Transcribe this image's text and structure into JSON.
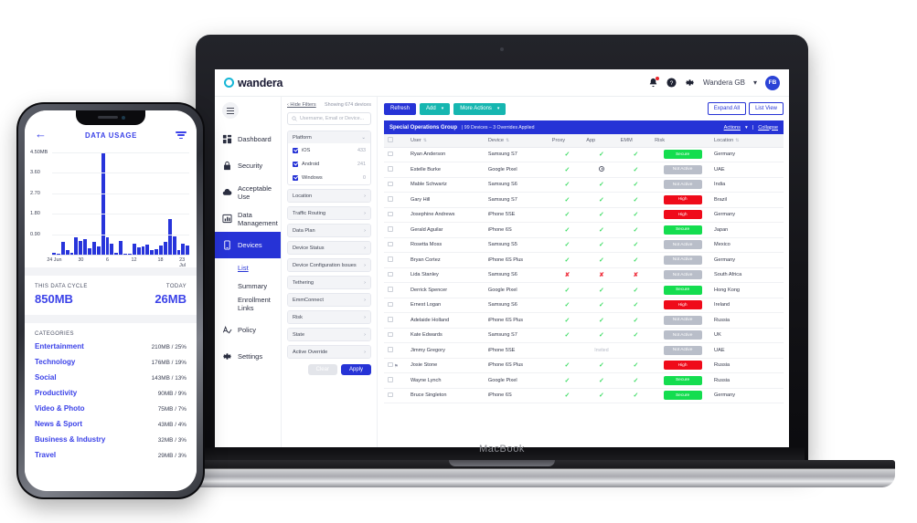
{
  "laptop": {
    "brand_label": "MacBook",
    "header": {
      "logo_text": "wandera",
      "logo_icon": "circle-o-icon",
      "bell_icon": "bell-icon",
      "help_icon": "help-circle-icon",
      "gear_icon": "gear-icon",
      "tenant": "Wandera GB",
      "tenant_caret": "▾",
      "avatar_initials": "FB"
    },
    "sidebar": {
      "menu_icon": "hamburger-icon",
      "items": [
        {
          "label": "Dashboard",
          "icon": "dashboard-icon",
          "active": false
        },
        {
          "label": "Security",
          "icon": "lock-icon",
          "active": false
        },
        {
          "label": "Acceptable Use",
          "icon": "cloud-icon",
          "active": false
        },
        {
          "label": "Data Management",
          "icon": "chart-bar-icon",
          "active": false
        },
        {
          "label": "Devices",
          "icon": "mobile-icon",
          "active": true
        }
      ],
      "sub_items": [
        {
          "label": "List",
          "selected": true
        },
        {
          "label": "Summary",
          "selected": false
        },
        {
          "label": "Enrollment Links",
          "selected": false
        }
      ],
      "footer_items": [
        {
          "label": "Policy",
          "icon": "policy-icon"
        },
        {
          "label": "Settings",
          "icon": "gear-icon"
        }
      ]
    },
    "filters": {
      "hide_link": "‹ Hide Filters",
      "showing": "Showing 674 devices",
      "search_placeholder": "Username, Email or Device...",
      "search_icon": "search-icon",
      "platform": {
        "label": "Platform",
        "caret": "⌄",
        "options": [
          {
            "label": "iOS",
            "count": "433",
            "checked": true
          },
          {
            "label": "Android",
            "count": "241",
            "checked": true
          },
          {
            "label": "Windows",
            "count": "0",
            "checked": true
          }
        ]
      },
      "groups": [
        "Location",
        "Traffic Routing",
        "Data Plan",
        "Device Status",
        "Device Configuration Issues",
        "Tethering",
        "EmmConnect",
        "Risk",
        "State",
        "Active Override"
      ],
      "chevron": "›",
      "clear_label": "Clear",
      "apply_label": "Apply"
    },
    "toolbar": {
      "refresh_label": "Refresh",
      "add_label": "Add",
      "more_actions_label": "More Actions",
      "caret": "▾",
      "expand_all_label": "Expand All",
      "list_view_label": "List View"
    },
    "group_bar": {
      "name": "Special Operations Group",
      "meta": "| 99 Devices – 3 Overrides Applied",
      "actions_label": "Actions",
      "actions_caret": "▾",
      "divider": "|",
      "collapse_label": "Collapse"
    },
    "table": {
      "columns": [
        "",
        "User",
        "Device",
        "Proxy",
        "App",
        "EMM",
        "Risk",
        "Location"
      ],
      "sort_icon": "sort-icon",
      "rows": [
        {
          "user": "Ryan Anderson",
          "device": "Samsung S7",
          "proxy": "tick",
          "app": "tick",
          "emm": "tick",
          "risk": "Secure",
          "risk_state": "secure",
          "location": "Germany"
        },
        {
          "user": "Estelle Burke",
          "device": "Google Pixel",
          "proxy": "tick",
          "app": "clock",
          "emm": "tick",
          "risk": "Not Active",
          "risk_state": "na",
          "location": "UAE"
        },
        {
          "user": "Mable Schwartz",
          "device": "Samsung S6",
          "proxy": "tick",
          "app": "tick",
          "emm": "tick",
          "risk": "Not Active",
          "risk_state": "na",
          "location": "India"
        },
        {
          "user": "Gary Hill",
          "device": "Samsung S7",
          "proxy": "tick",
          "app": "tick",
          "emm": "tick",
          "risk": "High",
          "risk_state": "high",
          "location": "Brazil"
        },
        {
          "user": "Josephine Andrews",
          "device": "iPhone 5SE",
          "proxy": "tick",
          "app": "tick",
          "emm": "tick",
          "risk": "High",
          "risk_state": "high",
          "location": "Germany"
        },
        {
          "user": "Gerald Aguilar",
          "device": "iPhone 6S",
          "proxy": "tick",
          "app": "tick",
          "emm": "tick",
          "risk": "Secure",
          "risk_state": "secure",
          "location": "Japan"
        },
        {
          "user": "Rosetta Moss",
          "device": "Samsung S5",
          "proxy": "tick",
          "app": "tick",
          "emm": "tick",
          "risk": "Not Active",
          "risk_state": "na",
          "location": "Mexico"
        },
        {
          "user": "Bryan Cortez",
          "device": "iPhone 6S Plus",
          "proxy": "tick",
          "app": "tick",
          "emm": "tick",
          "risk": "Not Active",
          "risk_state": "na",
          "location": "Germany"
        },
        {
          "user": "Lida Stanley",
          "device": "Samsung S6",
          "proxy": "cross",
          "app": "cross",
          "emm": "cross",
          "risk": "Not Active",
          "risk_state": "na",
          "location": "South Africa"
        },
        {
          "user": "Derrick Spencer",
          "device": "Google Pixel",
          "proxy": "tick",
          "app": "tick",
          "emm": "tick",
          "risk": "Secure",
          "risk_state": "secure",
          "location": "Hong Kong"
        },
        {
          "user": "Ernest Logan",
          "device": "Samsung S6",
          "proxy": "tick",
          "app": "tick",
          "emm": "tick",
          "risk": "High",
          "risk_state": "high",
          "location": "Ireland"
        },
        {
          "user": "Adelaide Holland",
          "device": "iPhone 6S Plus",
          "proxy": "tick",
          "app": "tick",
          "emm": "tick",
          "risk": "Not Active",
          "risk_state": "na",
          "location": "Russia"
        },
        {
          "user": "Kate Edwards",
          "device": "Samsung S7",
          "proxy": "tick",
          "app": "tick",
          "emm": "tick",
          "risk": "Not Active",
          "risk_state": "na",
          "location": "UK"
        },
        {
          "user": "Jimmy Gregory",
          "device": "iPhone 5SE",
          "proxy": "",
          "app": "invited",
          "emm": "",
          "risk": "Not Active",
          "risk_state": "na",
          "location": "UAE"
        },
        {
          "user": "Josie Stone",
          "device": "iPhone 6S Plus",
          "proxy": "tick",
          "app": "tick",
          "emm": "tick",
          "risk": "High",
          "risk_state": "high",
          "location": "Russia",
          "flag": "⚑"
        },
        {
          "user": "Wayne Lynch",
          "device": "Google Pixel",
          "proxy": "tick",
          "app": "tick",
          "emm": "tick",
          "risk": "Secure",
          "risk_state": "secure",
          "location": "Russia"
        },
        {
          "user": "Bruce Singleton",
          "device": "iPhone 6S",
          "proxy": "tick",
          "app": "tick",
          "emm": "tick",
          "risk": "Secure",
          "risk_state": "secure",
          "location": "Germany"
        }
      ],
      "invited_label": "Invited"
    }
  },
  "phone": {
    "back_icon": "arrow-left-icon",
    "title": "DATA USAGE",
    "filter_icon": "filter-icon",
    "chart_data": {
      "type": "bar",
      "title": "DATA USAGE",
      "xlabel": "",
      "ylabel": "MB",
      "ylim": [
        0,
        4.5
      ],
      "ytick_labels": [
        "4.50MB",
        "3.60",
        "2.70",
        "1.80",
        "0.90"
      ],
      "ytick_values": [
        4.5,
        3.6,
        2.7,
        1.8,
        0.9
      ],
      "xtick_labels": [
        "24 Jun",
        "30",
        "6",
        "12",
        "18",
        "23 Jul"
      ],
      "xtick_positions": [
        0,
        6,
        12,
        18,
        24,
        29
      ],
      "categories": [
        "24 Jun",
        "25",
        "26",
        "27",
        "28",
        "29",
        "30",
        "1",
        "2",
        "3",
        "4",
        "5",
        "6",
        "7",
        "8",
        "9",
        "10",
        "11",
        "12",
        "13",
        "14",
        "15",
        "16",
        "17",
        "18",
        "19",
        "20",
        "21",
        "22",
        "23 Jul"
      ],
      "values": [
        0.1,
        0.05,
        0.55,
        0.22,
        0.1,
        0.78,
        0.62,
        0.7,
        0.3,
        0.55,
        0.38,
        4.5,
        0.78,
        0.48,
        0.1,
        0.62,
        0.05,
        0.06,
        0.5,
        0.32,
        0.36,
        0.44,
        0.22,
        0.26,
        0.42,
        0.55,
        1.55,
        0.82,
        0.2,
        0.48,
        0.42
      ],
      "grid": true,
      "legend": "none",
      "bar_color": "#2734db"
    },
    "cycle": {
      "left_label": "THIS DATA CYCLE",
      "left_value": "850MB",
      "right_label": "TODAY",
      "right_value": "26MB"
    },
    "categories_title": "CATEGORIES",
    "categories": [
      {
        "name": "Entertainment",
        "value": "210MB / 25%"
      },
      {
        "name": "Technology",
        "value": "176MB / 19%"
      },
      {
        "name": "Social",
        "value": "143MB / 13%"
      },
      {
        "name": "Productivity",
        "value": "90MB / 9%"
      },
      {
        "name": "Video & Photo",
        "value": "75MB / 7%"
      },
      {
        "name": "News & Sport",
        "value": "43MB / 4%"
      },
      {
        "name": "Business & Industry",
        "value": "32MB / 3%"
      },
      {
        "name": "Travel",
        "value": "29MB / 3%"
      }
    ]
  },
  "colors": {
    "brand_blue": "#2633d6",
    "brand_teal": "#16b6b0",
    "secure_green": "#14dd4f",
    "high_red": "#ef0b1a",
    "inactive_grey": "#b9bec9",
    "phone_blue": "#3b42e8"
  }
}
